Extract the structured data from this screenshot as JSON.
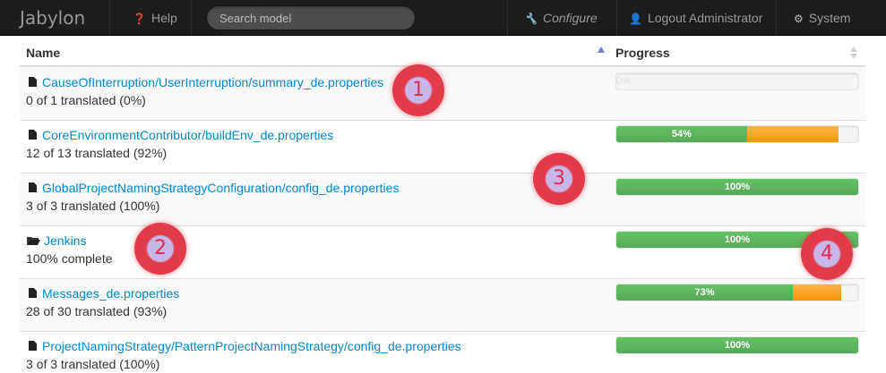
{
  "navbar": {
    "brand": "Jabylon",
    "help": "Help",
    "search_placeholder": "Search model",
    "configure": "Configure",
    "logout": "Logout Administrator",
    "system": "System"
  },
  "table": {
    "col_name": "Name",
    "col_progress": "Progress",
    "rows": [
      {
        "kind": "file",
        "link": "CauseOfInterruption/UserInterruption/summary_de.properties",
        "sub": "0 of 1 translated (0%)",
        "progress_green": 0,
        "progress_orange": 0,
        "bar_label": "0%"
      },
      {
        "kind": "file",
        "link": "CoreEnvironmentContributor/buildEnv_de.properties",
        "sub": "12 of 13 translated (92%)",
        "progress_green": 54,
        "progress_orange": 38,
        "bar_label": "54%"
      },
      {
        "kind": "file",
        "link": "GlobalProjectNamingStrategyConfiguration/config_de.properties",
        "sub": "3 of 3 translated (100%)",
        "progress_green": 100,
        "progress_orange": 0,
        "bar_label": "100%"
      },
      {
        "kind": "folder",
        "link": "Jenkins",
        "sub": "100% complete",
        "progress_green": 100,
        "progress_orange": 0,
        "bar_label": "100%"
      },
      {
        "kind": "file",
        "link": "Messages_de.properties",
        "sub": "28 of 30 translated (93%)",
        "progress_green": 73,
        "progress_orange": 20,
        "bar_label": "73%"
      },
      {
        "kind": "file",
        "link": "ProjectNamingStrategy/PatternProjectNamingStrategy/config_de.properties",
        "sub": "3 of 3 translated (100%)",
        "progress_green": 100,
        "progress_orange": 0,
        "bar_label": "100%"
      }
    ]
  },
  "markers": [
    "1",
    "2",
    "3",
    "4"
  ],
  "colors": {
    "link": "#0088cc",
    "progress_green": "#5eb95e",
    "progress_orange": "#f89406",
    "marker": "#e23b4c"
  }
}
